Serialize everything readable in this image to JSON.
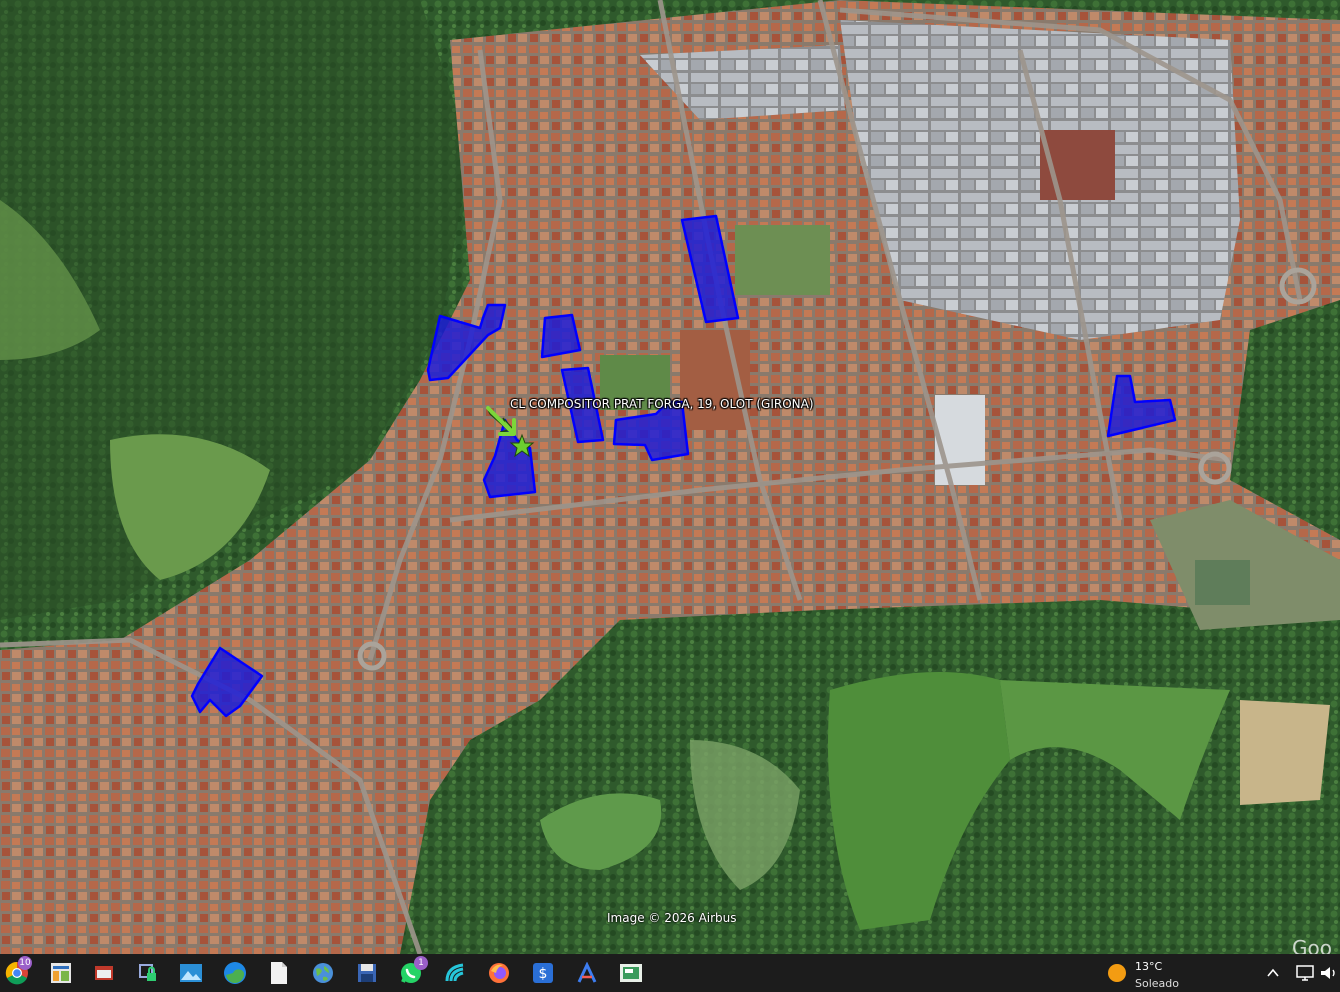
{
  "map": {
    "placemark_label": "CL COMPOSITOR PRAT FORGA, 19, OLOT (GIRONA)",
    "imagery_credit": "Image © 2026 Airbus",
    "brand_fragment": "Goo",
    "highlight_color": "#1a1adc",
    "highlight_outline": "#0000ff",
    "marker_color": "#7dd63a"
  },
  "taskbar": {
    "apps": [
      {
        "name": "chrome-icon"
      },
      {
        "name": "spreadsheet-icon"
      },
      {
        "name": "window-manager-icon"
      },
      {
        "name": "network-lock-icon"
      },
      {
        "name": "photos-icon"
      },
      {
        "name": "edge-icon"
      },
      {
        "name": "document-icon"
      },
      {
        "name": "globe-icon"
      },
      {
        "name": "save-disk-icon"
      },
      {
        "name": "whatsapp-icon"
      },
      {
        "name": "wave-app-icon"
      },
      {
        "name": "firefox-icon"
      },
      {
        "name": "dollar-app-icon"
      },
      {
        "name": "arc-app-icon"
      },
      {
        "name": "slides-icon"
      }
    ],
    "chrome_badge": "10",
    "whatsapp_badge": "1",
    "weather": {
      "temp": "13°C",
      "desc": "Soleado"
    }
  }
}
